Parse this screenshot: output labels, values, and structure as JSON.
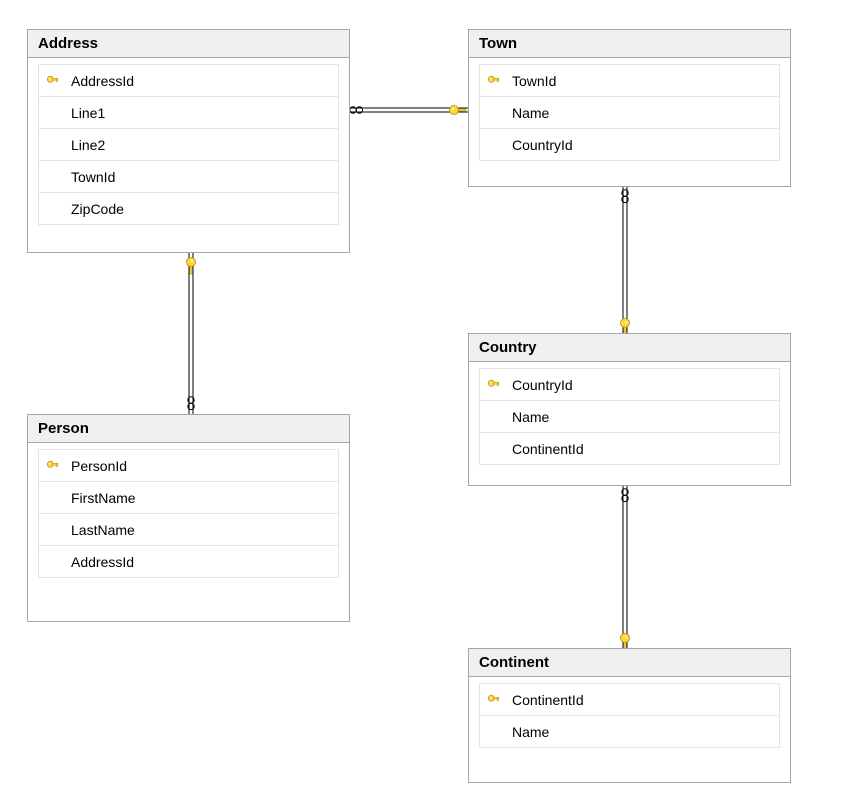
{
  "tables": {
    "address": {
      "title": "Address",
      "columns": [
        {
          "name": "AddressId",
          "pk": true
        },
        {
          "name": "Line1",
          "pk": false
        },
        {
          "name": "Line2",
          "pk": false
        },
        {
          "name": "TownId",
          "pk": false
        },
        {
          "name": "ZipCode",
          "pk": false
        }
      ]
    },
    "town": {
      "title": "Town",
      "columns": [
        {
          "name": "TownId",
          "pk": true
        },
        {
          "name": "Name",
          "pk": false
        },
        {
          "name": "CountryId",
          "pk": false
        }
      ]
    },
    "person": {
      "title": "Person",
      "columns": [
        {
          "name": "PersonId",
          "pk": true
        },
        {
          "name": "FirstName",
          "pk": false
        },
        {
          "name": "LastName",
          "pk": false
        },
        {
          "name": "AddressId",
          "pk": false
        }
      ]
    },
    "country": {
      "title": "Country",
      "columns": [
        {
          "name": "CountryId",
          "pk": true
        },
        {
          "name": "Name",
          "pk": false
        },
        {
          "name": "ContinentId",
          "pk": false
        }
      ]
    },
    "continent": {
      "title": "Continent",
      "columns": [
        {
          "name": "ContinentId",
          "pk": true
        },
        {
          "name": "Name",
          "pk": false
        }
      ]
    }
  },
  "relationships": [
    {
      "from": "Address.TownId",
      "to": "Town.TownId"
    },
    {
      "from": "Person.AddressId",
      "to": "Address.AddressId"
    },
    {
      "from": "Town.CountryId",
      "to": "Country.CountryId"
    },
    {
      "from": "Country.ContinentId",
      "to": "Continent.ContinentId"
    }
  ]
}
